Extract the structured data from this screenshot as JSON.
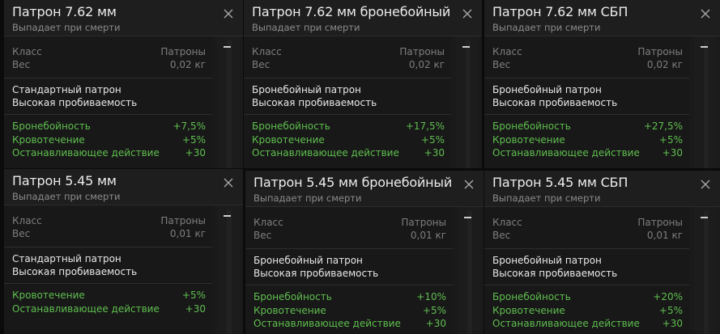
{
  "cards": [
    {
      "title": "Патрон 7.62 мм",
      "subtitle": "Выпадает при смерти",
      "class_label": "Класс",
      "class_value": "Патроны",
      "weight_label": "Вес",
      "weight_value": "0,02 кг",
      "desc_line1": "Стандартный патрон",
      "desc_line2": "Высокая пробиваемость",
      "stats": [
        {
          "label": "Бронебойность",
          "value": "+7,5%"
        },
        {
          "label": "Кровотечение",
          "value": "+5%"
        },
        {
          "label": "Останавливающее действие",
          "value": "+30"
        }
      ]
    },
    {
      "title": "Патрон 7.62 мм бронебойный",
      "subtitle": "Выпадает при смерти",
      "class_label": "Класс",
      "class_value": "Патроны",
      "weight_label": "Вес",
      "weight_value": "0,02 кг",
      "desc_line1": "Бронебойный патрон",
      "desc_line2": "Высокая пробиваемость",
      "stats": [
        {
          "label": "Бронебойность",
          "value": "+17,5%"
        },
        {
          "label": "Кровотечение",
          "value": "+5%"
        },
        {
          "label": "Останавливающее действие",
          "value": "+30"
        }
      ]
    },
    {
      "title": "Патрон 7.62 мм СБП",
      "subtitle": "Выпадает при смерти",
      "class_label": "Класс",
      "class_value": "Патроны",
      "weight_label": "Вес",
      "weight_value": "0,02 кг",
      "desc_line1": "Бронебойный патрон",
      "desc_line2": "Высокая пробиваемость",
      "stats": [
        {
          "label": "Бронебойность",
          "value": "+27,5%"
        },
        {
          "label": "Кровотечение",
          "value": "+5%"
        },
        {
          "label": "Останавливающее действие",
          "value": "+30"
        }
      ]
    },
    {
      "title": "Патрон 5.45 мм",
      "subtitle": "Выпадает при смерти",
      "class_label": "Класс",
      "class_value": "Патроны",
      "weight_label": "Вес",
      "weight_value": "0,01 кг",
      "desc_line1": "Стандартный патрон",
      "desc_line2": "Высокая пробиваемость",
      "stats": [
        {
          "label": "Кровотечение",
          "value": "+5%"
        },
        {
          "label": "Останавливающее действие",
          "value": "+30"
        }
      ]
    },
    {
      "title": "Патрон 5.45 мм бронебойный",
      "subtitle": "Выпадает при смерти",
      "class_label": "Класс",
      "class_value": "Патроны",
      "weight_label": "Вес",
      "weight_value": "0,01 кг",
      "desc_line1": "Бронебойный патрон",
      "desc_line2": "Высокая пробиваемость",
      "stats": [
        {
          "label": "Бронебойность",
          "value": "+10%"
        },
        {
          "label": "Кровотечение",
          "value": "+5%"
        },
        {
          "label": "Останавливающее действие",
          "value": "+30"
        }
      ]
    },
    {
      "title": "Патрон 5.45 мм СБП",
      "subtitle": "Выпадает при смерти",
      "class_label": "Класс",
      "class_value": "Патроны",
      "weight_label": "Вес",
      "weight_value": "0,01 кг",
      "desc_line1": "Бронебойный патрон",
      "desc_line2": "Высокая пробиваемость",
      "stats": [
        {
          "label": "Бронебойность",
          "value": "+20%"
        },
        {
          "label": "Кровотечение",
          "value": "+5%"
        },
        {
          "label": "Останавливающее действие",
          "value": "+30"
        }
      ]
    }
  ],
  "icons": {
    "close": "close-icon",
    "scroll": "scrollbar-thumb"
  },
  "colors": {
    "stat_positive": "#5fbf4f",
    "text_primary": "#e8e8e8",
    "text_muted": "#7e7e7e"
  }
}
